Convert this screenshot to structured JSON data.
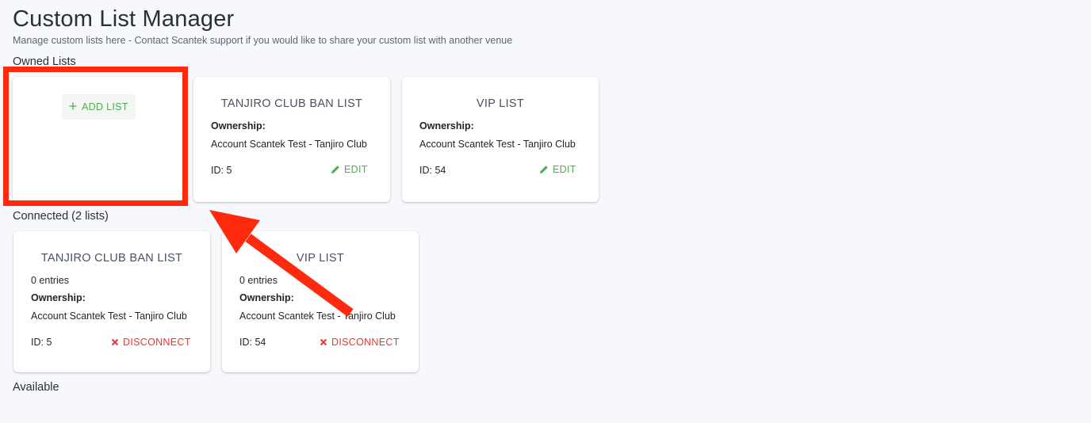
{
  "header": {
    "title": "Custom List Manager",
    "subtitle": "Manage custom lists here - Contact Scantek support if you would like to share your custom list with another venue"
  },
  "owned": {
    "label": "Owned Lists",
    "add_label": "ADD LIST",
    "cards": [
      {
        "title": "TANJIRO CLUB BAN LIST",
        "ownership_label": "Ownership:",
        "ownership_value": "Account Scantek Test - Tanjiro Club",
        "id_text": "ID: 5",
        "action_label": "EDIT"
      },
      {
        "title": "VIP LIST",
        "ownership_label": "Ownership:",
        "ownership_value": "Account Scantek Test - Tanjiro Club",
        "id_text": "ID: 54",
        "action_label": "EDIT"
      }
    ]
  },
  "connected": {
    "label": "Connected (2 lists)",
    "cards": [
      {
        "title": "TANJIRO CLUB BAN LIST",
        "entries": "0 entries",
        "ownership_label": "Ownership:",
        "ownership_value": "Account Scantek Test - Tanjiro Club",
        "id_text": "ID: 5",
        "action_label": "DISCONNECT"
      },
      {
        "title": "VIP LIST",
        "entries": "0 entries",
        "ownership_label": "Ownership:",
        "ownership_value": "Account Scantek Test - Tanjiro Club",
        "id_text": "ID: 54",
        "action_label": "DISCONNECT"
      }
    ]
  },
  "available": {
    "label": "Available"
  },
  "icons": {
    "add": "plus-icon",
    "edit": "pencil-icon",
    "disconnect": "close-icon"
  },
  "colors": {
    "background": "#f7f8fc",
    "edit_green": "#4caf50",
    "disconnect_red": "#e53935",
    "annotation_red": "#ff2a0e"
  }
}
